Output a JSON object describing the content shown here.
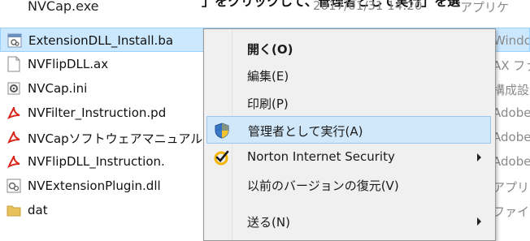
{
  "caption": "」をクリックして、管理者として実行」を選",
  "top_row": {
    "name": "NVCap.exe",
    "date": "2017/01/31 14:20",
    "type": "アプリケ"
  },
  "files": [
    {
      "name": "ExtensionDLL_Install.ba",
      "type": "Windo",
      "icon": "batch-file-icon",
      "selected": true
    },
    {
      "name": "NVFlipDLL.ax",
      "type": "AX ファ",
      "icon": "blank-file-icon",
      "selected": false
    },
    {
      "name": "NVCap.ini",
      "type": "構成設",
      "icon": "config-file-icon",
      "selected": false
    },
    {
      "name": "NVFilter_Instruction.pd",
      "type": "Adobe",
      "icon": "pdf-icon",
      "selected": false
    },
    {
      "name": "NVCapソフトウェアマニュアル",
      "type": "Adobe",
      "icon": "pdf-icon",
      "selected": false
    },
    {
      "name": "NVFlipDLL_Instruction.",
      "type": "Adobe",
      "icon": "pdf-icon",
      "selected": false
    },
    {
      "name": "NVExtensionPlugin.dll",
      "type": "アプリケー",
      "icon": "dll-file-icon",
      "selected": false
    },
    {
      "name": "dat",
      "type": "ファイル",
      "icon": "folder-icon",
      "selected": false
    }
  ],
  "context_menu": {
    "items": [
      {
        "label": "開く(O)",
        "bold": true,
        "hover": false,
        "icon": "",
        "submenu": false
      },
      {
        "label": "編集(E)",
        "bold": false,
        "hover": false,
        "icon": "",
        "submenu": false
      },
      {
        "label": "印刷(P)",
        "bold": false,
        "hover": false,
        "icon": "",
        "submenu": false
      },
      {
        "label": "管理者として実行(A)",
        "bold": false,
        "hover": true,
        "icon": "uac-shield-icon",
        "submenu": false
      },
      {
        "label": "Norton Internet Security",
        "bold": false,
        "hover": false,
        "icon": "norton-check-icon",
        "submenu": true
      },
      {
        "label": "以前のバージョンの復元(V)",
        "bold": false,
        "hover": false,
        "icon": "",
        "submenu": false
      },
      {
        "label": "送る(N)",
        "bold": false,
        "hover": false,
        "icon": "",
        "submenu": true
      }
    ]
  },
  "colors": {
    "selection_bg": "#cce8ff",
    "menu_bg": "#f0f0f0",
    "menu_hover": "#d1e8fb",
    "pdf_red": "#d9261c",
    "folder_yellow": "#e8c15a",
    "norton_yellow": "#f5b400"
  }
}
